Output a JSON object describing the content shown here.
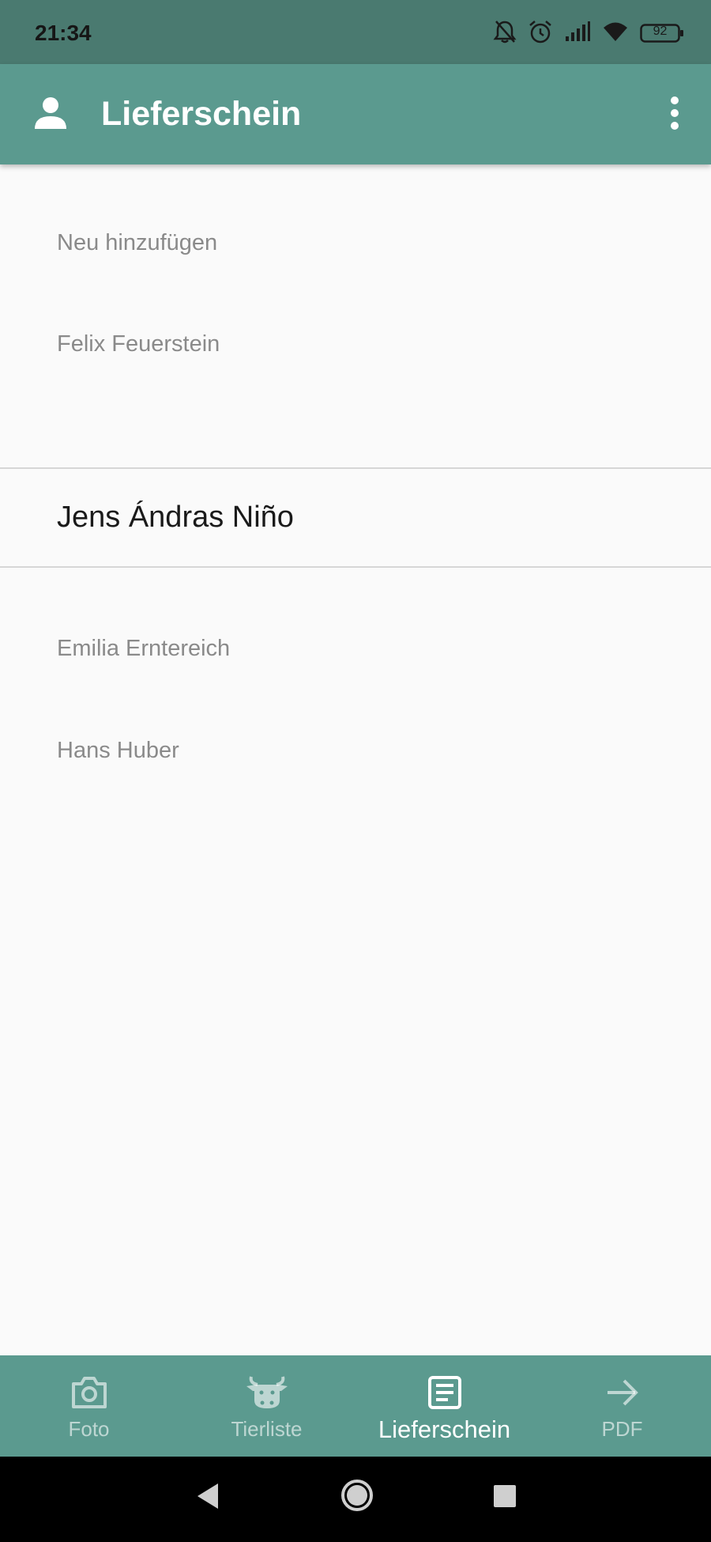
{
  "status_bar": {
    "time": "21:34",
    "battery": "92",
    "icons": [
      "bell-off-icon",
      "alarm-icon",
      "signal-icon",
      "wifi-icon",
      "battery-icon"
    ]
  },
  "app_bar": {
    "title": "Lieferschein",
    "leading_icon": "person-icon",
    "trailing_icon": "more-vert-icon",
    "color": "#5b9a8f"
  },
  "list": {
    "items": [
      {
        "label": "Neu hinzufügen",
        "selected": false
      },
      {
        "label": "Felix Feuerstein",
        "selected": false
      },
      {
        "label": "Jens Ándras Niño",
        "selected": true
      },
      {
        "label": "Emilia Erntereich",
        "selected": false
      },
      {
        "label": "Hans Huber",
        "selected": false
      }
    ]
  },
  "bottom_nav": {
    "tabs": [
      {
        "label": "Foto",
        "icon": "camera-icon",
        "active": false
      },
      {
        "label": "Tierliste",
        "icon": "cow-icon",
        "active": false
      },
      {
        "label": "Lieferschein",
        "icon": "document-icon",
        "active": true
      },
      {
        "label": "PDF",
        "icon": "arrow-right-icon",
        "active": false
      }
    ]
  }
}
